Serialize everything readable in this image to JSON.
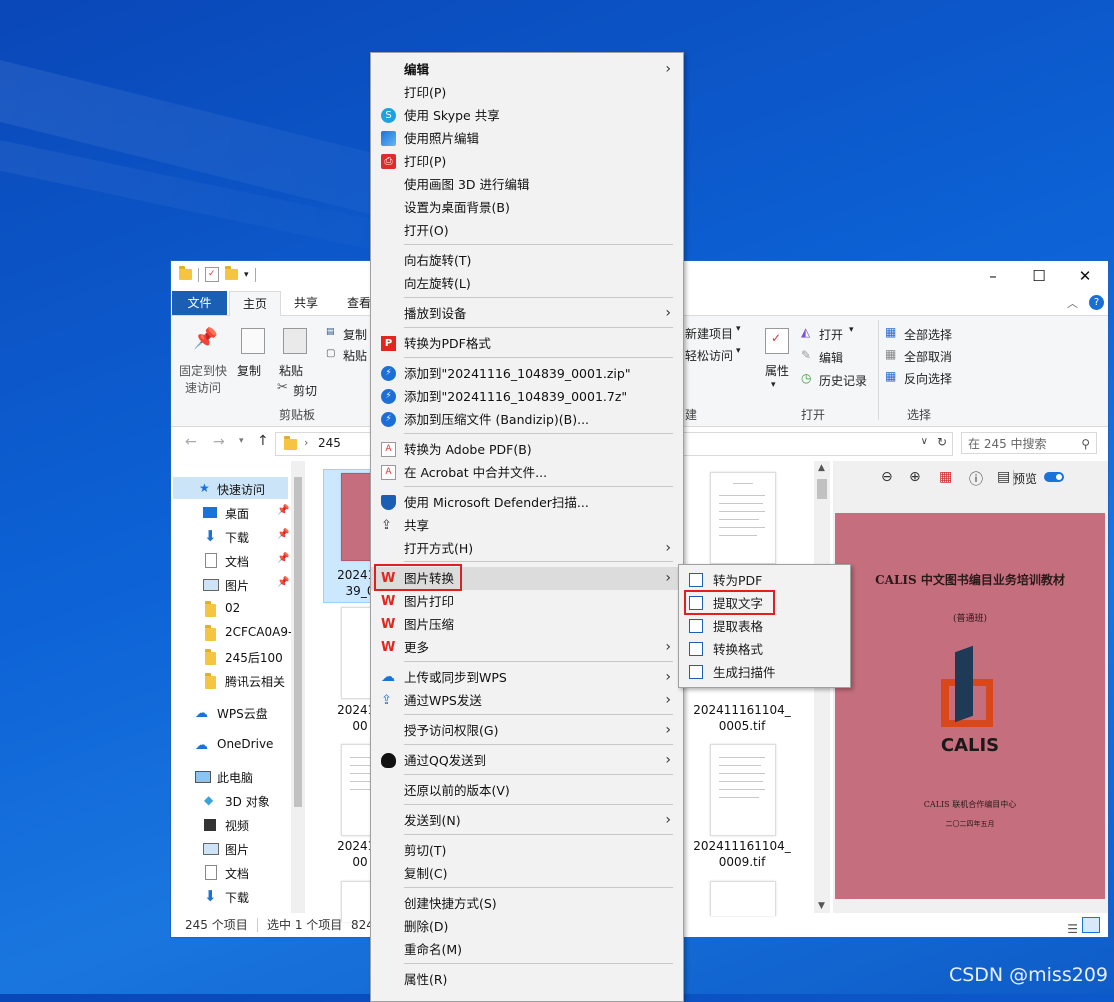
{
  "watermark": "CSDN @miss209",
  "explorer": {
    "tabs": {
      "file": "文件",
      "home": "主页",
      "share": "共享",
      "view": "查看"
    },
    "ribbon": {
      "pin": "固定到快速访问",
      "pin_l1": "固定到快",
      "pin_l2": "速访问",
      "copy": "复制",
      "paste": "粘贴",
      "cut": "剪切",
      "copy_path": "复制",
      "paste_shortcut": "粘贴",
      "clipboard": "剪贴板",
      "new_item": "新建项目",
      "easy_access": "轻松访问",
      "new_group_tail": "建",
      "properties": "属性",
      "open": "打开",
      "edit": "编辑",
      "history": "历史记录",
      "open_group": "打开",
      "select_all": "全部选择",
      "select_none": "全部取消",
      "invert": "反向选择",
      "select_group": "选择"
    },
    "address": {
      "path": "245",
      "search_placeholder": "在 245 中搜索"
    },
    "nav": {
      "quick_access": "快速访问",
      "items": [
        "桌面",
        "下载",
        "文档",
        "图片",
        "02",
        "2CFCA0A9-",
        "245后100",
        "腾讯云相关"
      ],
      "wps_cloud": "WPS云盘",
      "onedrive": "OneDrive",
      "this_pc": "此电脑",
      "pc_items": [
        "3D 对象",
        "视频",
        "图片",
        "文档",
        "下载"
      ]
    },
    "files": {
      "sel_line1": "202411",
      "sel_line2": "39_0",
      "f2_l1": "202411",
      "f2_l2": "00",
      "f3_l1": "202411",
      "f3_l2": "00",
      "right1_l1": "202411161104_",
      "right1_l2": "0005.tif",
      "right2_l1": "202411161104_",
      "right2_l2": "0009.tif"
    },
    "preview": {
      "label": "预览",
      "doc_title": "CALIS 中文图书编目业务培训教材",
      "doc_subtitle": "(普通班)",
      "logo_text": "CALIS",
      "org": "CALIS 联机合作编目中心",
      "date": "二〇二四年五月"
    },
    "status": {
      "count": "245 个项目",
      "selected": "选中 1 个项目",
      "size": "824"
    }
  },
  "menu": {
    "items": [
      {
        "label": "编辑",
        "bold": true,
        "arrow": true
      },
      {
        "label": "打印(P)"
      },
      {
        "label": "使用 Skype 共享",
        "icon": "skype-icon"
      },
      {
        "label": "使用照片编辑",
        "icon": "photos-icon"
      },
      {
        "label": "打印(P)",
        "icon": "printer-icon"
      },
      {
        "label": "使用画图 3D 进行编辑"
      },
      {
        "label": "设置为桌面背景(B)"
      },
      {
        "label": "打开(O)"
      },
      {
        "label": "向右旋转(T)"
      },
      {
        "label": "向左旋转(L)"
      },
      {
        "label": "播放到设备",
        "arrow": true
      },
      {
        "label": "转换为PDF格式",
        "icon": "pdf-convert-icon"
      },
      {
        "label": "添加到\"20241116_104839_0001.zip\"",
        "icon": "bandizip-icon"
      },
      {
        "label": "添加到\"20241116_104839_0001.7z\"",
        "icon": "bandizip-icon"
      },
      {
        "label": "添加到压缩文件 (Bandizip)(B)...",
        "icon": "bandizip-icon"
      },
      {
        "label": "转换为 Adobe PDF(B)",
        "icon": "acrobat-icon"
      },
      {
        "label": "在 Acrobat 中合并文件...",
        "icon": "acrobat-combine-icon"
      },
      {
        "label": "使用 Microsoft Defender扫描...",
        "icon": "defender-icon"
      },
      {
        "label": "共享",
        "icon": "share-icon"
      },
      {
        "label": "打开方式(H)",
        "arrow": true
      },
      {
        "label": "图片转换",
        "icon": "wps-icon",
        "arrow": true
      },
      {
        "label": "图片打印",
        "icon": "wps-icon"
      },
      {
        "label": "图片压缩",
        "icon": "wps-icon"
      },
      {
        "label": "更多",
        "icon": "wps-icon",
        "arrow": true
      },
      {
        "label": "上传或同步到WPS",
        "icon": "wps-cloud-icon",
        "arrow": true
      },
      {
        "label": "通过WPS发送",
        "icon": "wps-send-icon",
        "arrow": true
      },
      {
        "label": "授予访问权限(G)",
        "arrow": true
      },
      {
        "label": "通过QQ发送到",
        "icon": "qq-icon",
        "arrow": true
      },
      {
        "label": "还原以前的版本(V)"
      },
      {
        "label": "发送到(N)",
        "arrow": true
      },
      {
        "label": "剪切(T)"
      },
      {
        "label": "复制(C)"
      },
      {
        "label": "创建快捷方式(S)"
      },
      {
        "label": "删除(D)"
      },
      {
        "label": "重命名(M)"
      },
      {
        "label": "属性(R)"
      }
    ]
  },
  "submenu": {
    "items": [
      "转为PDF",
      "提取文字",
      "提取表格",
      "转换格式",
      "生成扫描件"
    ]
  }
}
